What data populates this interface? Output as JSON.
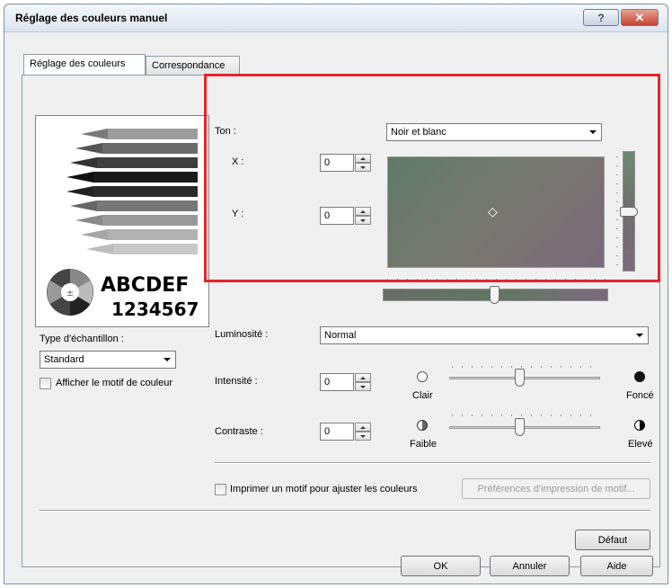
{
  "window": {
    "title": "Réglage des couleurs manuel",
    "help_glyph": "?",
    "close_glyph": "✕"
  },
  "tabs": [
    {
      "label": "Réglage des couleurs"
    },
    {
      "label": "Correspondance"
    }
  ],
  "preview": {
    "text_letters": "ABCDEF",
    "text_numbers": "1234567"
  },
  "sample_type": {
    "label": "Type d'échantillon :",
    "value": "Standard"
  },
  "show_pattern": {
    "label": "Afficher le motif de couleur",
    "checked": false
  },
  "tone": {
    "label": "Ton :",
    "value": "Noir et blanc",
    "x_label": "X :",
    "x_value": "0",
    "y_label": "Y :",
    "y_value": "0",
    "marker": "◇"
  },
  "brightness": {
    "label": "Luminosité :",
    "value": "Normal"
  },
  "intensity": {
    "label": "Intensité :",
    "value": "0",
    "left_label": "Clair",
    "right_label": "Foncé",
    "level": 0.5
  },
  "contrast": {
    "label": "Contraste :",
    "value": "0",
    "left_label": "Faible",
    "right_label": "Elevé",
    "level": 0.5
  },
  "print_pattern": {
    "label": "Imprimer un motif pour ajuster les couleurs",
    "checked": false,
    "prefs_button": "Préférences d'impression de motif..."
  },
  "buttons": {
    "default": "Défaut",
    "ok": "OK",
    "cancel": "Annuler",
    "help": "Aide"
  },
  "colors": {
    "highlight_frame": "#e8242b",
    "tone_field": "#6e7472"
  }
}
